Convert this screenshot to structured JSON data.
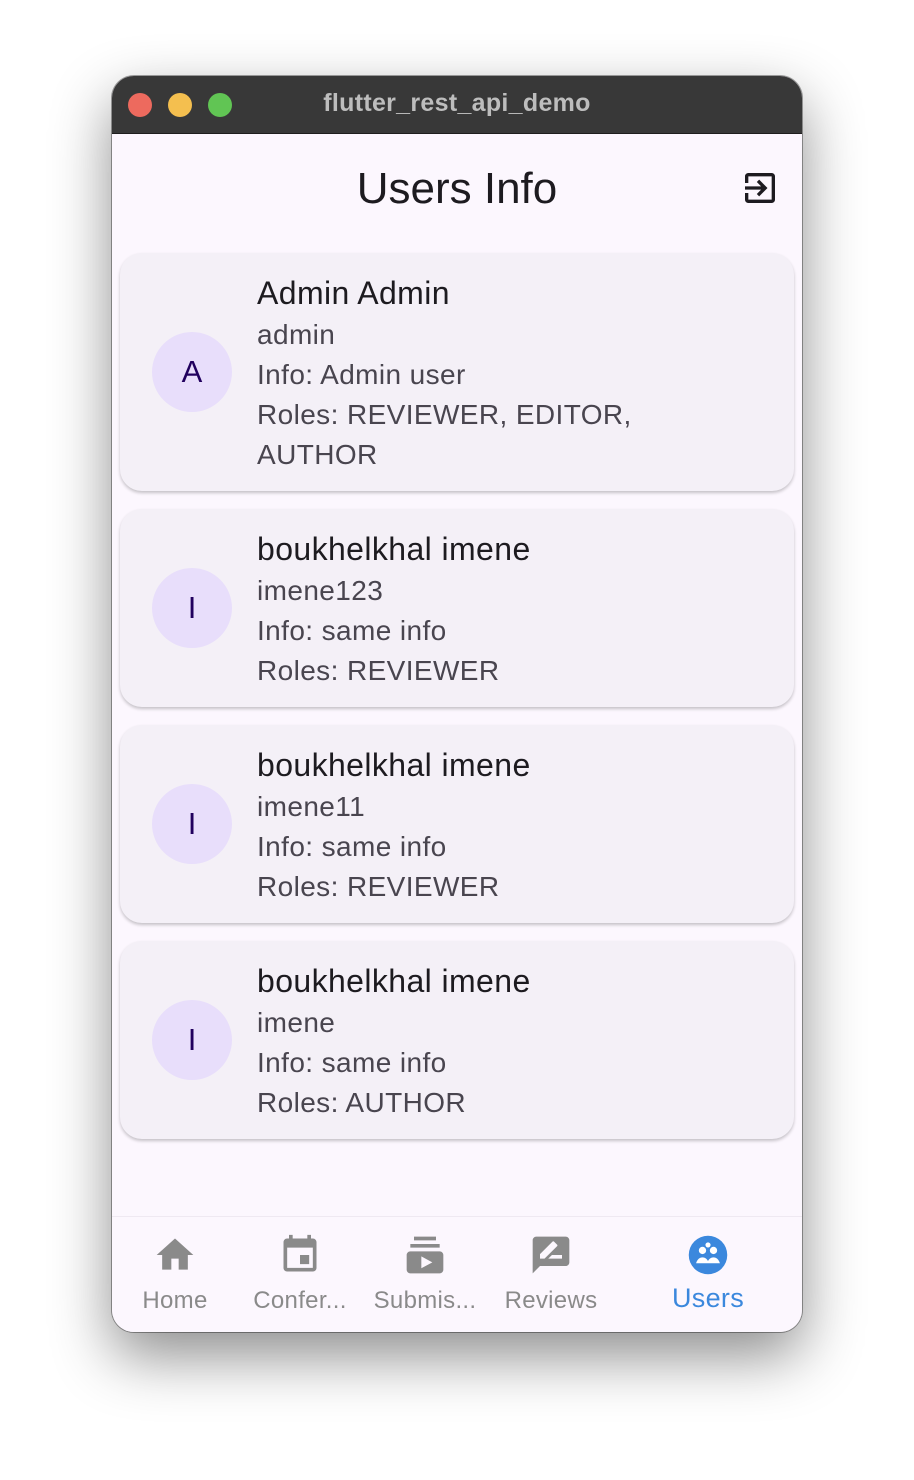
{
  "window": {
    "title": "flutter_rest_api_demo"
  },
  "appbar": {
    "title": "Users Info",
    "logout_icon": "logout-icon"
  },
  "users": [
    {
      "initial": "A",
      "name": "Admin Admin",
      "username": "admin",
      "info": "Info: Admin user",
      "roles_line1": "Roles: REVIEWER, EDITOR,",
      "roles_line2": "AUTHOR"
    },
    {
      "initial": "I",
      "name": "boukhelkhal imene",
      "username": "imene123",
      "info": "Info: same info",
      "roles_line1": "Roles: REVIEWER"
    },
    {
      "initial": "I",
      "name": "boukhelkhal imene",
      "username": "imene11",
      "info": "Info: same info",
      "roles_line1": "Roles: REVIEWER"
    },
    {
      "initial": "I",
      "name": "boukhelkhal imene",
      "username": "imene",
      "info": "Info: same info",
      "roles_line1": "Roles: AUTHOR"
    }
  ],
  "bottom_nav": {
    "items": [
      {
        "label": "Home",
        "icon": "home-icon"
      },
      {
        "label": "Confer...",
        "icon": "calendar-icon"
      },
      {
        "label": "Submis...",
        "icon": "subscriptions-icon"
      },
      {
        "label": "Reviews",
        "icon": "rate-review-icon"
      },
      {
        "label": "Users",
        "icon": "users-group-icon",
        "active": true
      }
    ]
  },
  "colors": {
    "active_nav": "#3b88dd",
    "inactive_nav": "#8a8a8a",
    "card_bg": "#f4f0f7",
    "avatar_bg": "#e8defb"
  }
}
